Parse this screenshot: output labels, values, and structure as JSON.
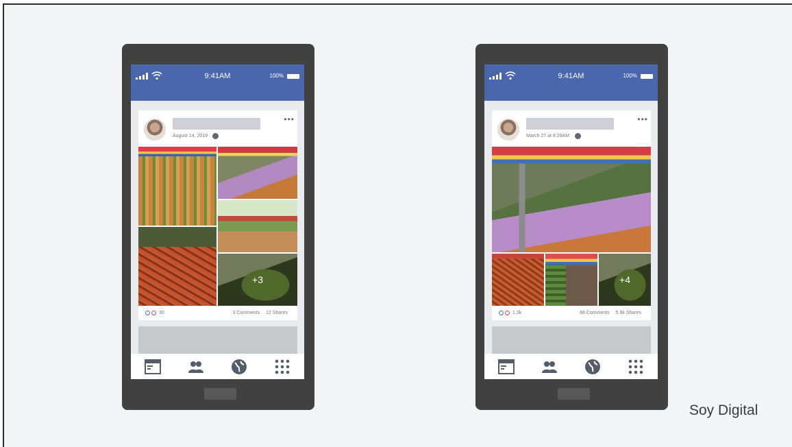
{
  "brand": "Soy Digital",
  "phones": [
    {
      "status": {
        "time": "9:41AM",
        "battery": "100%"
      },
      "post": {
        "date": "August 14, 2019",
        "reactions_count": "30",
        "comments": "3 Comments",
        "shares": "12 Shares",
        "more_photos": "+3"
      }
    },
    {
      "status": {
        "time": "9:41AM",
        "battery": "100%"
      },
      "post": {
        "date": "March 27 at 8:29AM",
        "reactions_count": "1.3k",
        "comments": "88 Comments",
        "shares": "5.9k Shares",
        "more_photos": "+4"
      }
    }
  ],
  "icons": [
    "news-feed-icon",
    "friends-icon",
    "globe-icon",
    "menu-grid-icon",
    "signal-icon",
    "wifi-icon",
    "battery-icon",
    "more-options-icon"
  ]
}
